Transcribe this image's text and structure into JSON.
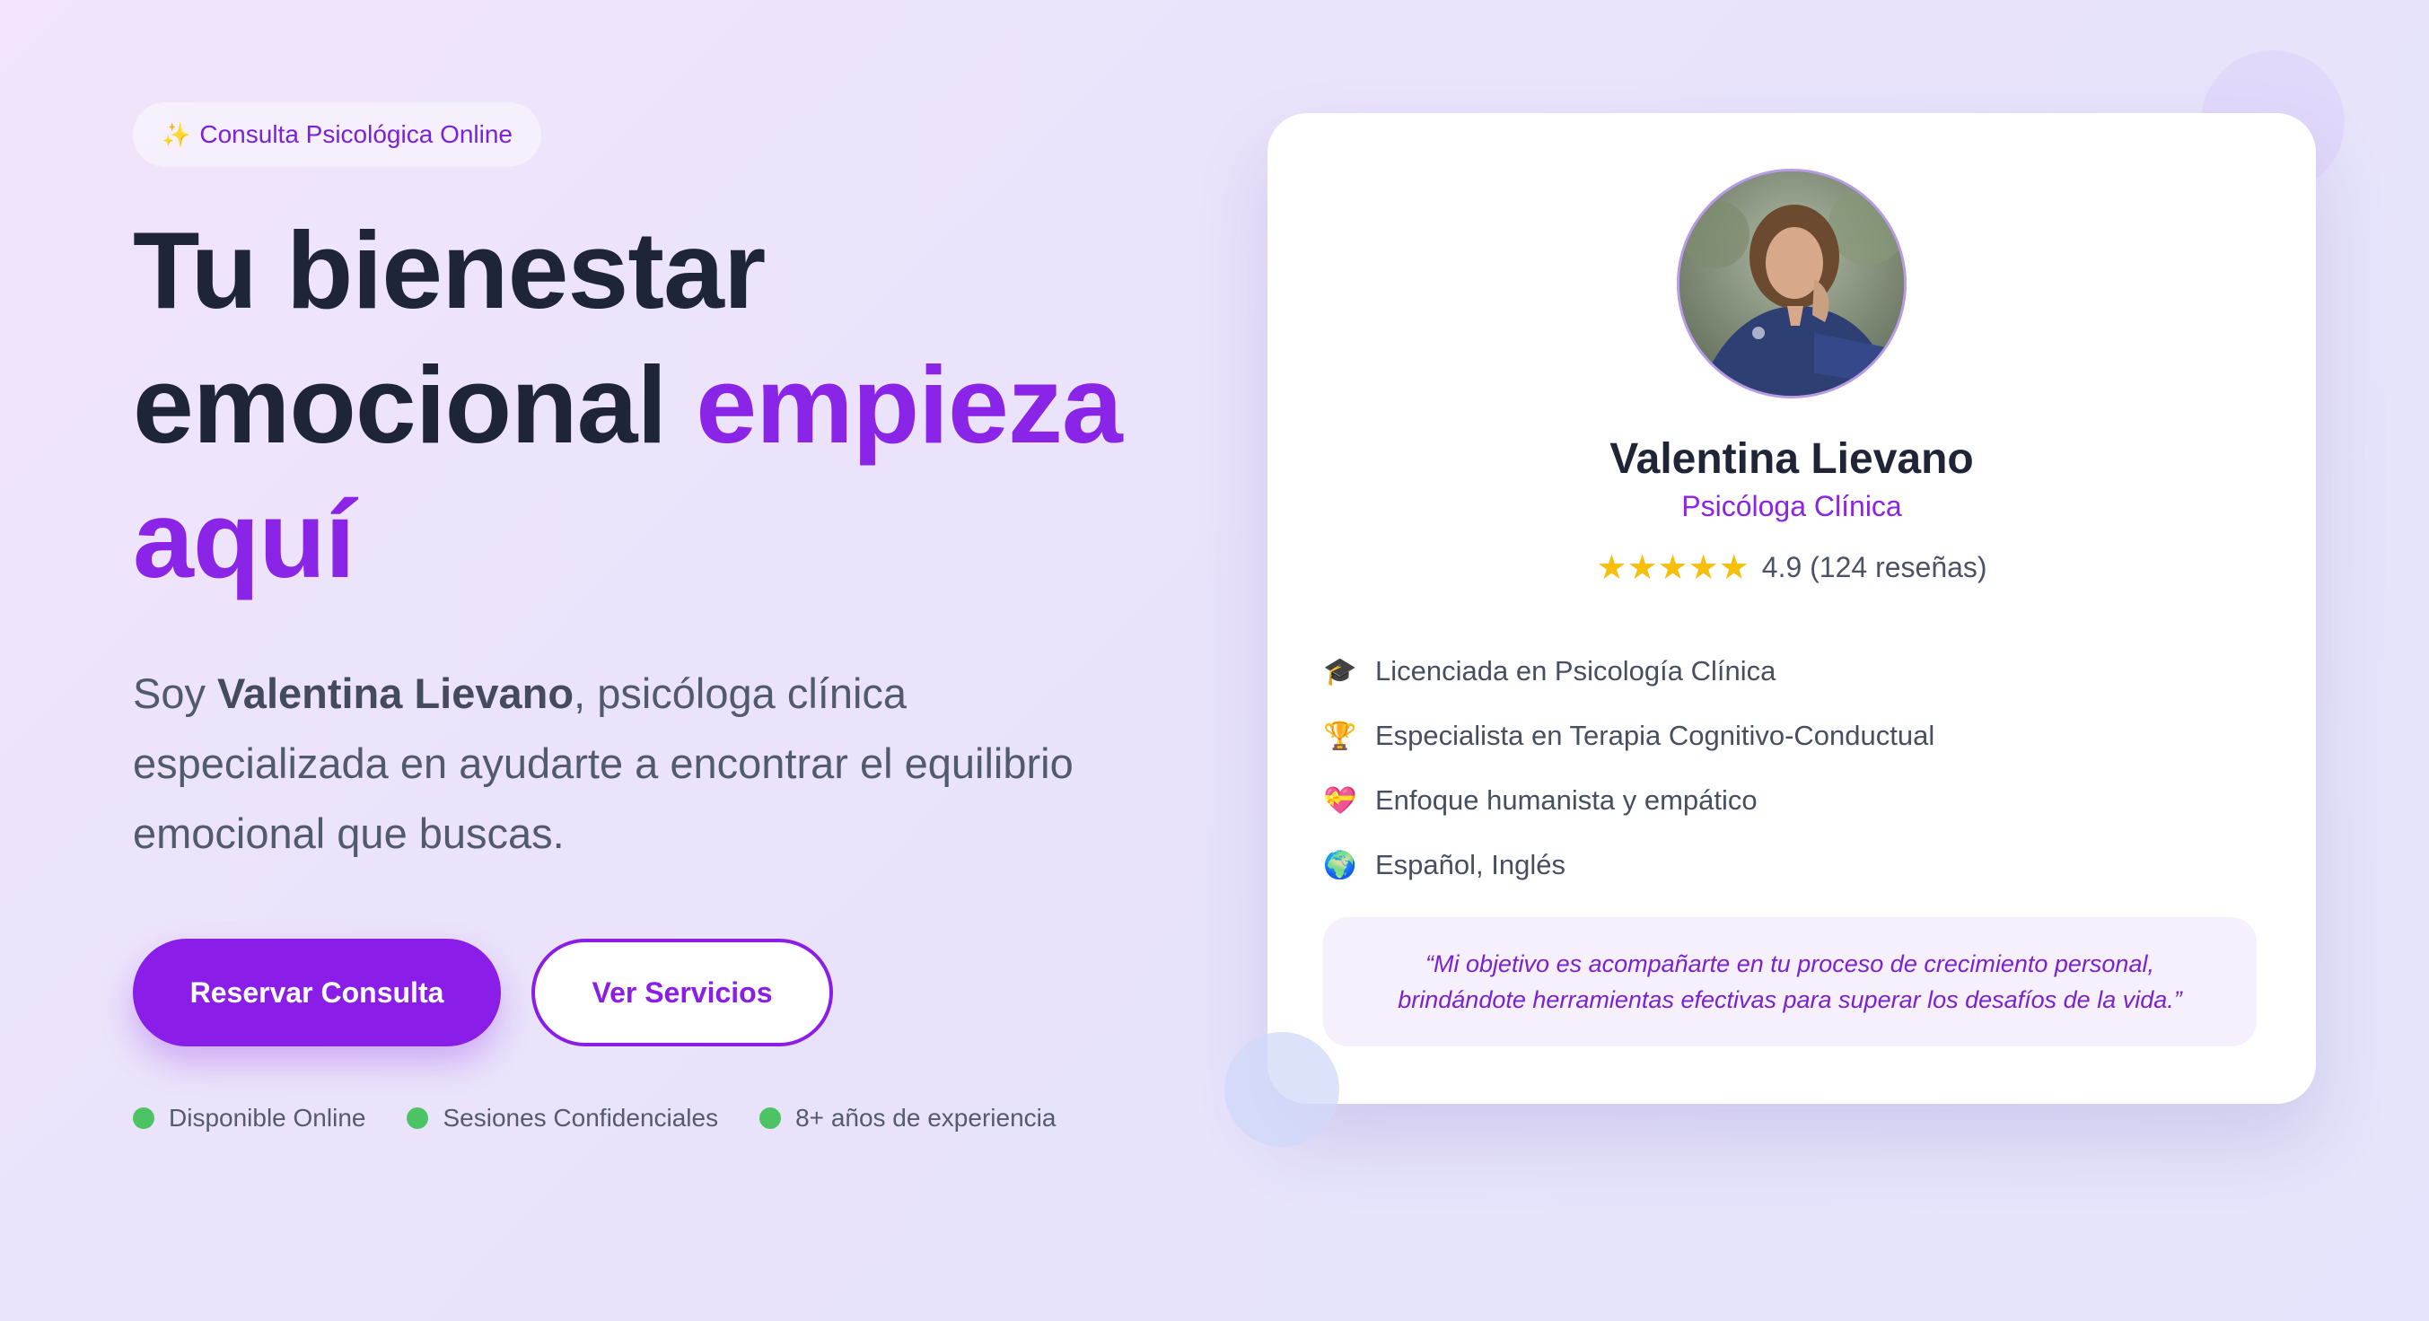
{
  "hero": {
    "badge_icon": "sparkles-icon",
    "badge_text": "Consulta Psicológica Online",
    "headline_line1": "Tu bienestar",
    "headline_line2a": "emocional ",
    "headline_line2b": "empieza",
    "headline_line3": "aquí",
    "intro_prefix": "Soy ",
    "intro_name": "Valentina Lievano",
    "intro_suffix": ", psicóloga clínica especializada en ayudarte a encontrar el equilibrio emocional que buscas.",
    "primary_button": "Reservar Consulta",
    "secondary_button": "Ver Servicios",
    "features": [
      "Disponible Online",
      "Sesiones Confidenciales",
      "8+ años de experiencia"
    ]
  },
  "profile": {
    "name": "Valentina Lievano",
    "role": "Psicóloga Clínica",
    "stars": "★★★★★",
    "rating_text": "4.9 (124 reseñas)",
    "credentials": [
      {
        "icon": "graduation-cap-icon",
        "glyph": "🎓",
        "text": "Licenciada en Psicología Clínica"
      },
      {
        "icon": "trophy-icon",
        "glyph": "🏆",
        "text": "Especialista en Terapia Cognitivo-Conductual"
      },
      {
        "icon": "heart-icon",
        "glyph": "💝",
        "text": "Enfoque humanista y empático"
      },
      {
        "icon": "globe-icon",
        "glyph": "🌍",
        "text": "Español, Inglés"
      }
    ],
    "quote": "“Mi objetivo es acompañarte en tu proceso de crecimiento personal, brindándote herramientas efectivas para superar los desafíos de la vida.”"
  },
  "colors": {
    "accent": "#8a1ee8",
    "headline": "#1e2538",
    "status_dot": "#4cc365",
    "star": "#f5bf0b"
  }
}
